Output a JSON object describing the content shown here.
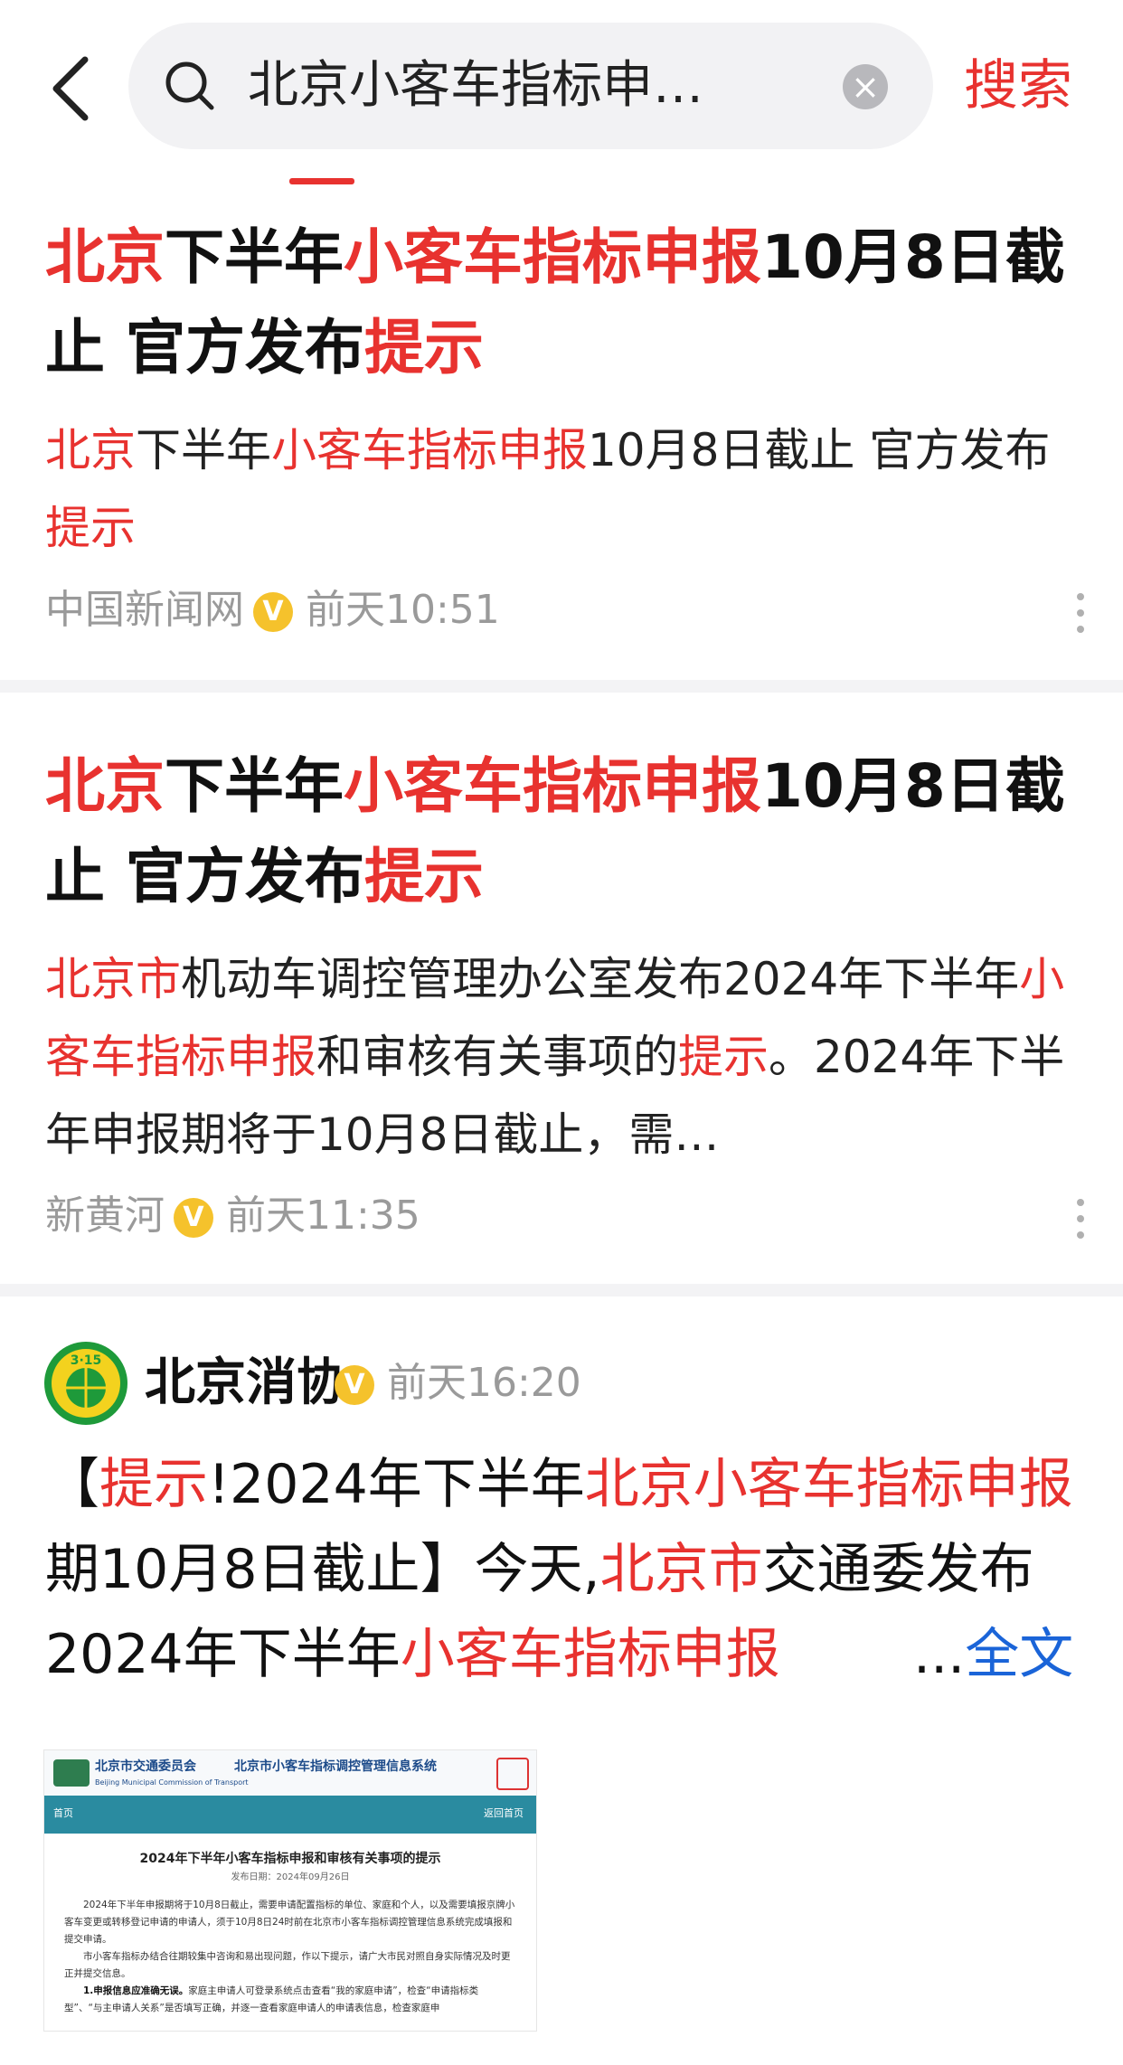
{
  "search": {
    "query": "北京小客车指标申…",
    "clear_icon": "clear-icon",
    "button": "搜索"
  },
  "results": [
    {
      "title": [
        {
          "t": "北京",
          "hl": true
        },
        {
          "t": "下半年",
          "hl": false
        },
        {
          "t": "小客车指标申报",
          "hl": true
        },
        {
          "t": "10月8日截止 官方发布",
          "hl": false
        },
        {
          "t": "提示",
          "hl": true
        }
      ],
      "snippet": [
        {
          "t": "北京",
          "hl": true
        },
        {
          "t": "下半年",
          "hl": false
        },
        {
          "t": "小客车指标申报",
          "hl": true
        },
        {
          "t": "10月8日截止 官方发布",
          "hl": false
        },
        {
          "t": "提示",
          "hl": true
        }
      ],
      "source": "中国新闻网",
      "badge": "V",
      "time": "前天10:51"
    },
    {
      "title": [
        {
          "t": "北京",
          "hl": true
        },
        {
          "t": "下半年",
          "hl": false
        },
        {
          "t": "小客车指标申报",
          "hl": true
        },
        {
          "t": "10月8日截止 官方发布",
          "hl": false
        },
        {
          "t": "提示",
          "hl": true
        }
      ],
      "snippet": [
        {
          "t": "北京市",
          "hl": true
        },
        {
          "t": "机动车调控管理办公室发布2024年下半年",
          "hl": false
        },
        {
          "t": "小客车指标申报",
          "hl": true
        },
        {
          "t": "和审核有关事项的",
          "hl": false
        },
        {
          "t": "提示",
          "hl": true
        },
        {
          "t": "。2024年下半年申报期将于10月8日截止，需…",
          "hl": false
        }
      ],
      "source": "新黄河",
      "badge": "V",
      "time": "前天11:35"
    }
  ],
  "post": {
    "author": "北京消协",
    "badge": "V",
    "time": "前天16:20",
    "avatar_text": "3·15",
    "content": [
      {
        "t": "【",
        "hl": false
      },
      {
        "t": "提示",
        "hl": true
      },
      {
        "t": "!2024年下半年",
        "hl": false
      },
      {
        "t": "北京小客车指标申报",
        "hl": true
      },
      {
        "t": "期10月8日截止】今天,",
        "hl": false
      },
      {
        "t": "北京市",
        "hl": true
      },
      {
        "t": "交通委发布2024年下半年",
        "hl": false
      },
      {
        "t": "小客车指标申报",
        "hl": true
      }
    ],
    "ellipsis": "...",
    "full_text_link": "全文",
    "image": {
      "org": "北京市交通委员会",
      "org_en": "Beijing Municipal Commission of Transport",
      "system": "北京市小客车指标调控管理信息系统",
      "nav_left": "首页",
      "nav_right": "返回首页",
      "doc_title": "2024年下半年小客车指标申报和审核有关事项的提示",
      "doc_date": "发布日期：2024年09月26日",
      "para1": "2024年下半年申报期将于10月8日截止，需要申请配置指标的单位、家庭和个人，以及需要填报京牌小客车变更或转移登记申请的申请人，须于10月8日24时前在北京市小客车指标调控管理信息系统完成填报和提交申请。",
      "para2": "市小客车指标办结合往期较集中咨询和易出现问题，作以下提示，请广大市民对照自身实际情况及时更正并提交信息。",
      "para3_bold": "1.申报信息应准确无误。",
      "para3": "家庭主申请人可登录系统点击查看“我的家庭申请”，检查“申请指标类型”、“与主申请人关系”是否填写正确，并逐一查看家庭申请人的申请表信息，检查家庭申"
    }
  },
  "colors": {
    "highlight": "#e8322f",
    "link": "#1a64d8",
    "meta": "#9a9a9a",
    "badge": "#f5c22c"
  }
}
